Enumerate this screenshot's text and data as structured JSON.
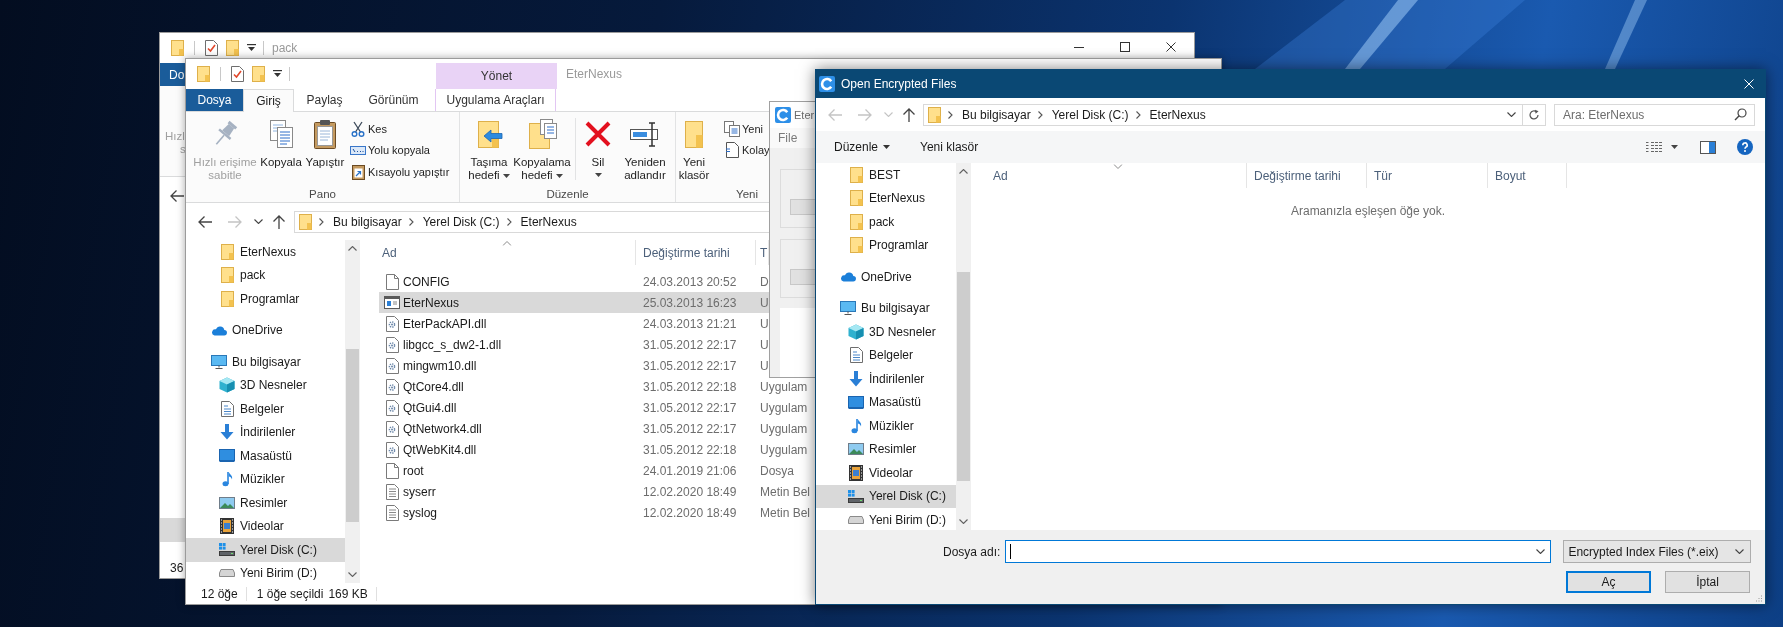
{
  "back_window": {
    "title": "pack",
    "tab": "Do",
    "ribbon_labels": [
      "Hızl",
      "s"
    ],
    "status": "36"
  },
  "explorer": {
    "title": "EterNexus",
    "context_group": "Yönet",
    "tabs": [
      {
        "label": "Dosya",
        "kind": "file",
        "selected": false
      },
      {
        "label": "Giriş",
        "kind": "normal",
        "selected": true
      },
      {
        "label": "Paylaş",
        "kind": "normal",
        "selected": false
      },
      {
        "label": "Görünüm",
        "kind": "normal",
        "selected": false
      },
      {
        "label": "Uygulama Araçları",
        "kind": "context",
        "selected": false
      }
    ],
    "ribbon": [
      {
        "label": "Pano",
        "sections": [
          {
            "large": [
              {
                "label": "Hızlı erişime\nsabitle",
                "kind": "pin",
                "menu": false,
                "disabled": true
              },
              {
                "label": "Kopyala",
                "kind": "copy",
                "menu": false,
                "disabled": false
              },
              {
                "label": "Yapıştır",
                "kind": "paste",
                "menu": false,
                "disabled": false
              }
            ],
            "small": [
              {
                "label": "Kes",
                "kind": "cut",
                "disabled": false
              },
              {
                "label": "Yolu kopyala",
                "kind": "copypath",
                "disabled": false
              },
              {
                "label": "Kısayolu yapıştır",
                "kind": "pasteshortcut",
                "disabled": false
              }
            ]
          }
        ]
      },
      {
        "label": "Düzenle",
        "sections": [
          {
            "large": [
              {
                "label": "Taşıma\nhedefi",
                "kind": "moveto",
                "menu": true,
                "disabled": false
              },
              {
                "label": "Kopyalama\nhedefi",
                "kind": "copyto",
                "menu": true,
                "disabled": false
              }
            ]
          },
          {
            "large": [
              {
                "label": "Sil",
                "kind": "delete",
                "menu": true,
                "disabled": false
              },
              {
                "label": "Yeniden\nadlandır",
                "kind": "rename",
                "menu": false,
                "disabled": false
              }
            ]
          }
        ]
      },
      {
        "label": "Yeni",
        "sections": [
          {
            "large": [
              {
                "label": "Yeni\nklasör",
                "kind": "newfolder",
                "menu": false,
                "disabled": false
              }
            ],
            "small": [
              {
                "label": "Yeni",
                "kind": "newitem",
                "disabled": false
              },
              {
                "label": "Kolay",
                "kind": "easyaccess",
                "disabled": false
              }
            ]
          }
        ]
      }
    ],
    "nav_buttons": [
      {
        "kind": "back",
        "disabled": false
      },
      {
        "kind": "forward",
        "disabled": true
      },
      {
        "kind": "recent",
        "disabled": false
      },
      {
        "kind": "up",
        "disabled": false
      }
    ],
    "address": [
      "Bu bilgisayar",
      "Yerel Disk (C:)",
      "EterNexus"
    ],
    "nav": [
      {
        "children": [
          {
            "label": "EterNexus",
            "kind": "folder",
            "selected": false
          },
          {
            "label": "pack",
            "kind": "folder",
            "selected": false
          },
          {
            "label": "Programlar",
            "kind": "folder",
            "selected": false
          }
        ]
      },
      {
        "label": "OneDrive",
        "kind": "cloud",
        "selected": false
      },
      {
        "label": "Bu bilgisayar",
        "kind": "computer",
        "selected": false,
        "children": [
          {
            "label": "3D Nesneler",
            "kind": "objects",
            "selected": false
          },
          {
            "label": "Belgeler",
            "kind": "documents",
            "selected": false
          },
          {
            "label": "İndirilenler",
            "kind": "downloads",
            "selected": false
          },
          {
            "label": "Masaüstü",
            "kind": "desktop",
            "selected": false
          },
          {
            "label": "Müzikler",
            "kind": "music",
            "selected": false
          },
          {
            "label": "Resimler",
            "kind": "pictures",
            "selected": false
          },
          {
            "label": "Videolar",
            "kind": "videos",
            "selected": false
          },
          {
            "label": "Yerel Disk (C:)",
            "kind": "systemdrive",
            "selected": true
          },
          {
            "label": "Yeni Birim (D:)",
            "kind": "drive",
            "selected": false
          }
        ]
      }
    ],
    "columns": [
      {
        "label": "Ad",
        "sorted": true,
        "descending": false
      },
      {
        "label": "Değiştirme tarihi",
        "sorted": false
      },
      {
        "label": "T"
      }
    ],
    "files": [
      {
        "name": "CONFIG",
        "kind": "file",
        "modified": "24.03.2013 20:52",
        "type": "D",
        "selected": false
      },
      {
        "name": "EterNexus",
        "kind": "app",
        "modified": "25.03.2013 16:23",
        "type": "U",
        "selected": true
      },
      {
        "name": "EterPackAPI.dll",
        "kind": "dll",
        "modified": "24.03.2013 21:21",
        "type": "U",
        "selected": false
      },
      {
        "name": "libgcc_s_dw2-1.dll",
        "kind": "dll",
        "modified": "31.05.2012 22:17",
        "type": "U",
        "selected": false
      },
      {
        "name": "mingwm10.dll",
        "kind": "dll",
        "modified": "31.05.2012 22:17",
        "type": "U",
        "selected": false
      },
      {
        "name": "QtCore4.dll",
        "kind": "dll",
        "modified": "31.05.2012 22:18",
        "type": "Uygulam",
        "selected": false
      },
      {
        "name": "QtGui4.dll",
        "kind": "dll",
        "modified": "31.05.2012 22:17",
        "type": "Uygulam",
        "selected": false
      },
      {
        "name": "QtNetwork4.dll",
        "kind": "dll",
        "modified": "31.05.2012 22:17",
        "type": "Uygulam",
        "selected": false
      },
      {
        "name": "QtWebKit4.dll",
        "kind": "dll",
        "modified": "31.05.2012 22:18",
        "type": "Uygulam",
        "selected": false
      },
      {
        "name": "root",
        "kind": "file",
        "modified": "24.01.2019 21:06",
        "type": "Dosya",
        "selected": false
      },
      {
        "name": "syserr",
        "kind": "text",
        "modified": "12.02.2020 18:49",
        "type": "Metin Bel",
        "selected": false
      },
      {
        "name": "syslog",
        "kind": "text",
        "modified": "12.02.2020 18:49",
        "type": "Metin Bel",
        "selected": false
      }
    ],
    "status": [
      "12 öğe",
      "1 öğe seçildi",
      "169 KB"
    ]
  },
  "app_window": {
    "title": "Eter",
    "menu": [
      "File"
    ]
  },
  "dialog": {
    "title": "Open Encrypted Files",
    "nav_buttons": [
      {
        "kind": "back",
        "disabled": true
      },
      {
        "kind": "forward",
        "disabled": true
      },
      {
        "kind": "recent",
        "disabled": true
      },
      {
        "kind": "up",
        "disabled": false
      }
    ],
    "address": [
      "Bu bilgisayar",
      "Yerel Disk (C:)",
      "EterNexus"
    ],
    "search": {
      "placeholder": "Ara: EterNexus"
    },
    "toolbar": [
      {
        "label": "Düzenle",
        "menu": true
      },
      {
        "label": "Yeni klasör",
        "menu": false
      }
    ],
    "nav": [
      {
        "children": [
          {
            "label": "BEST",
            "kind": "folder",
            "selected": false
          },
          {
            "label": "EterNexus",
            "kind": "folder",
            "selected": false
          },
          {
            "label": "pack",
            "kind": "folder",
            "selected": false
          },
          {
            "label": "Programlar",
            "kind": "folder",
            "selected": false
          }
        ]
      },
      {
        "label": "OneDrive",
        "kind": "cloud",
        "selected": false
      },
      {
        "label": "Bu bilgisayar",
        "kind": "computer",
        "selected": false,
        "children": [
          {
            "label": "3D Nesneler",
            "kind": "objects",
            "selected": false
          },
          {
            "label": "Belgeler",
            "kind": "documents",
            "selected": false
          },
          {
            "label": "İndirilenler",
            "kind": "downloads",
            "selected": false
          },
          {
            "label": "Masaüstü",
            "kind": "desktop",
            "selected": false
          },
          {
            "label": "Müzikler",
            "kind": "music",
            "selected": false
          },
          {
            "label": "Resimler",
            "kind": "pictures",
            "selected": false
          },
          {
            "label": "Videolar",
            "kind": "videos",
            "selected": false
          },
          {
            "label": "Yerel Disk (C:)",
            "kind": "systemdrive",
            "selected": true
          },
          {
            "label": "Yeni Birim (D:)",
            "kind": "drive",
            "selected": false
          }
        ]
      }
    ],
    "columns": [
      {
        "label": "Ad",
        "sorted": true,
        "descending": true
      },
      {
        "label": "Değiştirme tarihi",
        "sorted": false
      },
      {
        "label": "Tür",
        "sorted": false
      },
      {
        "label": "Boyut",
        "sorted": false
      }
    ],
    "empty_message": "Aramanızla eşleşen öğe yok.",
    "filename": {
      "label": "Dosya adı:",
      "focused": true
    },
    "filter": "Encrypted Index Files (*.eix)",
    "buttons": [
      {
        "label": "Aç",
        "default": true
      },
      {
        "label": "İptal",
        "default": false
      }
    ]
  }
}
